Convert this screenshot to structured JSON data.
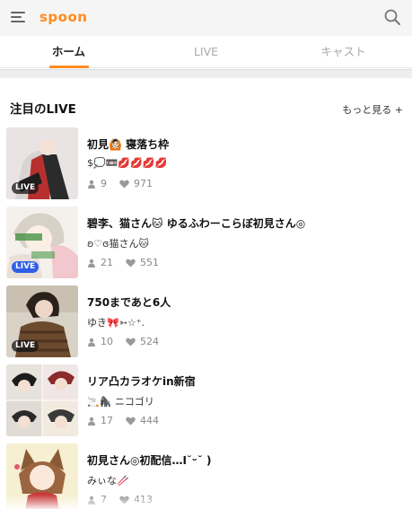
{
  "header": {
    "logo_text": "spoon",
    "menu_icon": "hamburger-menu-icon",
    "search_icon": "search-icon",
    "brand_color": "#ff8a1f"
  },
  "tabs": [
    {
      "label": "ホーム",
      "active": true
    },
    {
      "label": "LIVE",
      "active": false
    },
    {
      "label": "キャスト",
      "active": false
    }
  ],
  "section": {
    "title": "注目のLIVE",
    "more_label": "もっと見る +"
  },
  "live_items": [
    {
      "title": "初見🙆🏻 寝落ち枠",
      "dj": "$💭📼💋💋💋💋",
      "listeners": "9",
      "likes": "971",
      "badge": "LIVE"
    },
    {
      "title": "碧李、猫さん🐱 ゆるふわーこらぼ初見さん◎",
      "dj": "ʚ♡ɞ猫さん🐱",
      "listeners": "21",
      "likes": "551",
      "badge": "LIVE"
    },
    {
      "title": "750まであと6人",
      "dj": "ゆき🎀➳☆⁺.",
      "listeners": "10",
      "likes": "524",
      "badge": "LIVE"
    },
    {
      "title": "リア凸カラオケin新宿",
      "dj": "🚬🦍 ニコゴリ",
      "listeners": "17",
      "likes": "444",
      "badge": ""
    },
    {
      "title": "初見さん◎初配信…I˘ᵕ˘ )",
      "dj": "みぃな🥢",
      "listeners": "7",
      "likes": "413",
      "badge": ""
    }
  ]
}
